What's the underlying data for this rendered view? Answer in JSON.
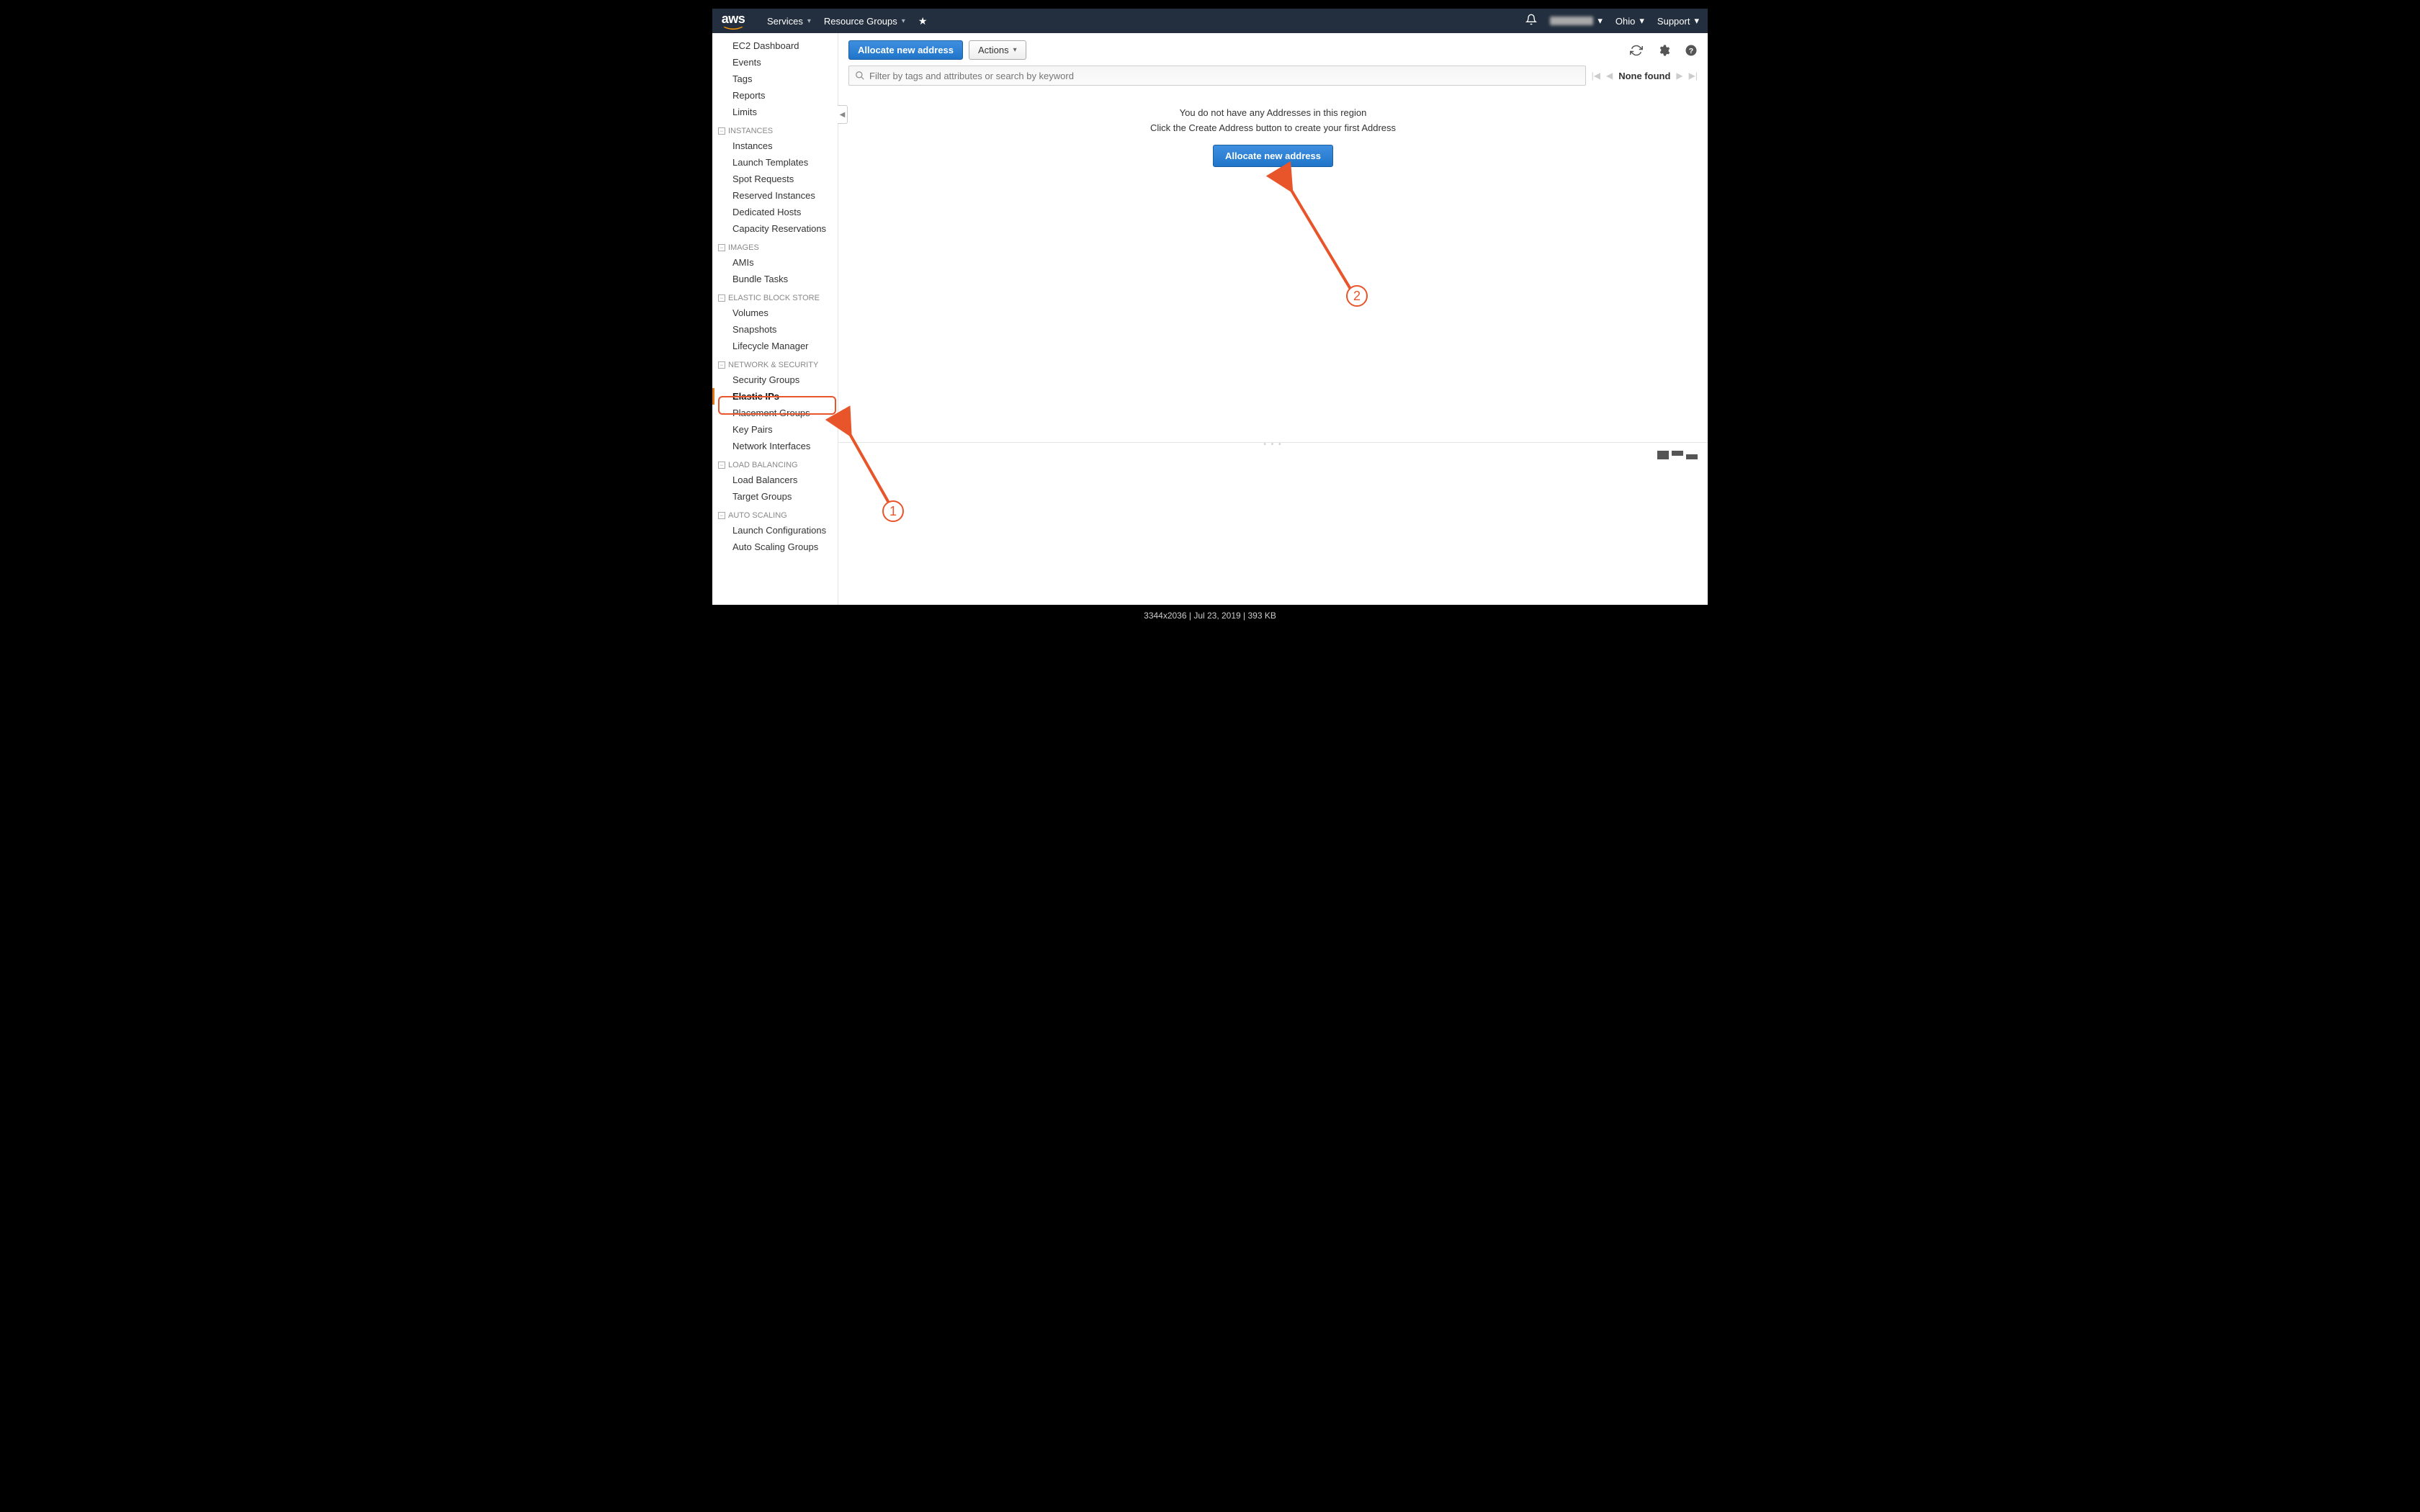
{
  "header": {
    "logo_text": "aws",
    "menu": {
      "services": "Services",
      "resource_groups": "Resource Groups"
    },
    "region": "Ohio",
    "support": "Support"
  },
  "sidebar": {
    "top": [
      "EC2 Dashboard",
      "Events",
      "Tags",
      "Reports",
      "Limits"
    ],
    "sections": [
      {
        "label": "INSTANCES",
        "items": [
          "Instances",
          "Launch Templates",
          "Spot Requests",
          "Reserved Instances",
          "Dedicated Hosts",
          "Capacity Reservations"
        ]
      },
      {
        "label": "IMAGES",
        "items": [
          "AMIs",
          "Bundle Tasks"
        ]
      },
      {
        "label": "ELASTIC BLOCK STORE",
        "items": [
          "Volumes",
          "Snapshots",
          "Lifecycle Manager"
        ]
      },
      {
        "label": "NETWORK & SECURITY",
        "items": [
          "Security Groups",
          "Elastic IPs",
          "Placement Groups",
          "Key Pairs",
          "Network Interfaces"
        ],
        "active_index": 1
      },
      {
        "label": "LOAD BALANCING",
        "items": [
          "Load Balancers",
          "Target Groups"
        ]
      },
      {
        "label": "AUTO SCALING",
        "items": [
          "Launch Configurations",
          "Auto Scaling Groups"
        ]
      }
    ]
  },
  "toolbar": {
    "allocate_label": "Allocate new address",
    "actions_label": "Actions"
  },
  "filter": {
    "placeholder": "Filter by tags and attributes or search by keyword",
    "found_label": "None found"
  },
  "empty_state": {
    "line1": "You do not have any Addresses in this region",
    "line2": "Click the Create Address button to create your first Address",
    "button": "Allocate new address"
  },
  "annotations": {
    "callout1": "1",
    "callout2": "2"
  },
  "footer_caption": "3344x2036 | Jul 23, 2019 | 393 KB"
}
